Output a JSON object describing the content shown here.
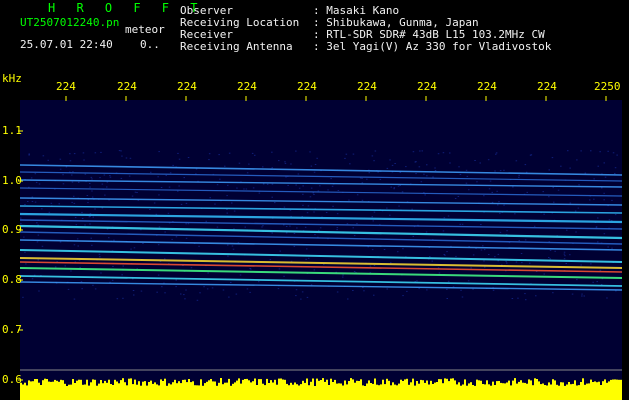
{
  "header": {
    "brand": "H R O F F T",
    "filename": "UT2507012240.pn",
    "mode": "meteor",
    "datetime": "25.07.01 22:40",
    "counter": "0..",
    "info_labels": [
      "Observer",
      "Receiving Location",
      "Receiver",
      "Receiving Antenna"
    ],
    "info_values": [
      ": Masaki Kano",
      ": Shibukawa, Gunma, Japan",
      ": RTL-SDR SDR# 43dB L15 103.2MHz CW",
      ": 3el Yagi(V) Az 330 for Vladivostok"
    ]
  },
  "axes": {
    "y_unit": "kHz",
    "y_ticks": [
      "1.1",
      "1.0",
      "0.9",
      "0.8",
      "0.7",
      "0.6"
    ],
    "x_ticks": [
      "224",
      "224",
      "224",
      "224",
      "224",
      "224",
      "224",
      "224",
      "224",
      "2250"
    ]
  },
  "colors": {
    "background": "#000000",
    "plot_bg": "#000033",
    "text_green": "#00ff00",
    "text_white": "#f2f2f2",
    "tick_yellow": "#ffff00",
    "signal_band": "#ffff00"
  }
}
